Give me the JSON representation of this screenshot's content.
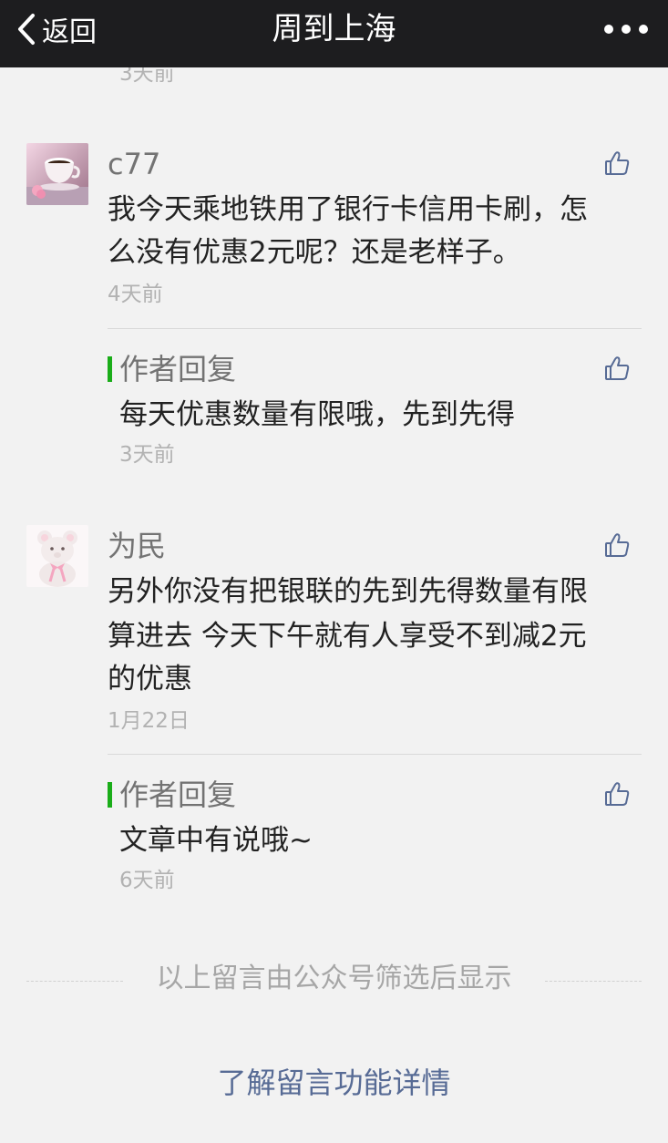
{
  "nav": {
    "back_label": "返回",
    "title": "周到上海",
    "back_icon": "chevron-left-icon",
    "more_icon": "more-dots-icon"
  },
  "top_partial_time": "3天前",
  "comments": [
    {
      "nickname": "c77",
      "avatar": "coffee-cup-avatar",
      "text_lines": [
        "我今天乘地铁用了银行卡信用卡刷，怎",
        "么没有优惠2元呢？还是老样子。"
      ],
      "time": "4天前",
      "reply": {
        "label": "作者回复",
        "text": "每天优惠数量有限哦，先到先得",
        "time": "3天前"
      }
    },
    {
      "nickname": "为民",
      "avatar": "teddy-bear-avatar",
      "text_lines": [
        "另外你没有把银联的先到先得数量有限",
        "算进去 今天下午就有人享受不到减2元",
        "的优惠"
      ],
      "time": "1月22日",
      "reply": {
        "label": "作者回复",
        "text": "文章中有说哦~",
        "time": "6天前"
      }
    }
  ],
  "footer": {
    "note": "以上留言由公众号筛选后显示",
    "link": "了解留言功能详情"
  },
  "colors": {
    "navbar_bg": "#1d1d1f",
    "page_bg": "#f2f2f2",
    "reply_accent": "#1aad19",
    "link": "#576b95",
    "like_icon": "#576b95"
  }
}
